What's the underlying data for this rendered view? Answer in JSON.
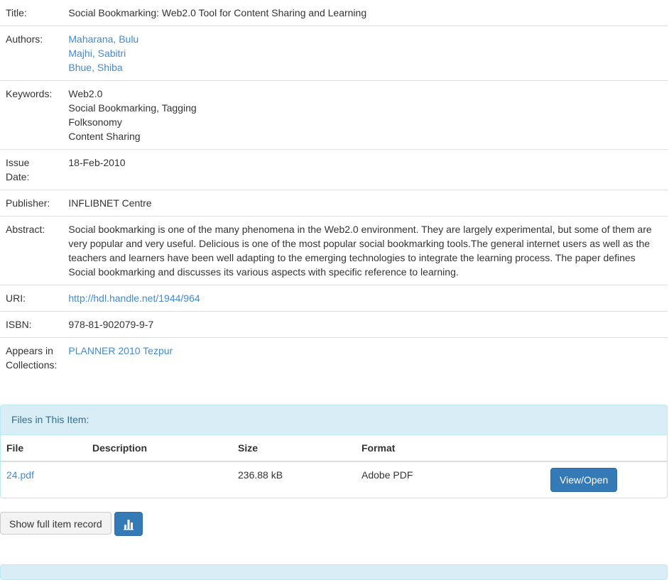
{
  "metadata": {
    "title_label": "Title:",
    "title_value": "Social Bookmarking: Web2.0 Tool for Content Sharing and Learning",
    "authors_label": "Authors:",
    "authors": [
      "Maharana, Bulu",
      "Majhi, Sabitri",
      "Bhue, Shiba"
    ],
    "keywords_label": "Keywords:",
    "keywords": [
      "Web2.0",
      "Social Bookmarking, Tagging",
      "Folksonomy",
      "Content Sharing"
    ],
    "issue_date_label_1": "Issue",
    "issue_date_label_2": "Date:",
    "issue_date_value": "18-Feb-2010",
    "publisher_label": "Publisher:",
    "publisher_value": "INFLIBNET Centre",
    "abstract_label": "Abstract:",
    "abstract_value": "Social bookmarking is one of the many phenomena in the Web2.0 environment. They are largely experimental, but some of them are very popular and very useful. Delicious is one of the most popular social bookmarking tools.The general internet users as well as the teachers and learners have been well adapting to the emerging technologies to integrate the learning process. The paper defines Social bookmarking and discusses its various aspects with specific reference to learning.",
    "uri_label": "URI:",
    "uri_value": "http://hdl.handle.net/1944/964",
    "isbn_label": "ISBN:",
    "isbn_value": "978-81-902079-9-7",
    "collections_label_1": "Appears in",
    "collections_label_2": "Collections:",
    "collections_value": "PLANNER 2010 Tezpur"
  },
  "files": {
    "heading": "Files in This Item:",
    "columns": [
      "File",
      "Description",
      "Size",
      "Format"
    ],
    "rows": [
      {
        "file": "24.pdf",
        "description": "",
        "size": "236.88 kB",
        "format": "Adobe PDF",
        "action": "View/Open"
      }
    ]
  },
  "actions": {
    "show_full_record": "Show full item record",
    "stats_icon": "bar-chart-icon"
  },
  "colors": {
    "link": "#428bca",
    "primary": "#337ab7",
    "panel_heading_bg": "#d9edf7",
    "panel_heading_text": "#31708f"
  }
}
